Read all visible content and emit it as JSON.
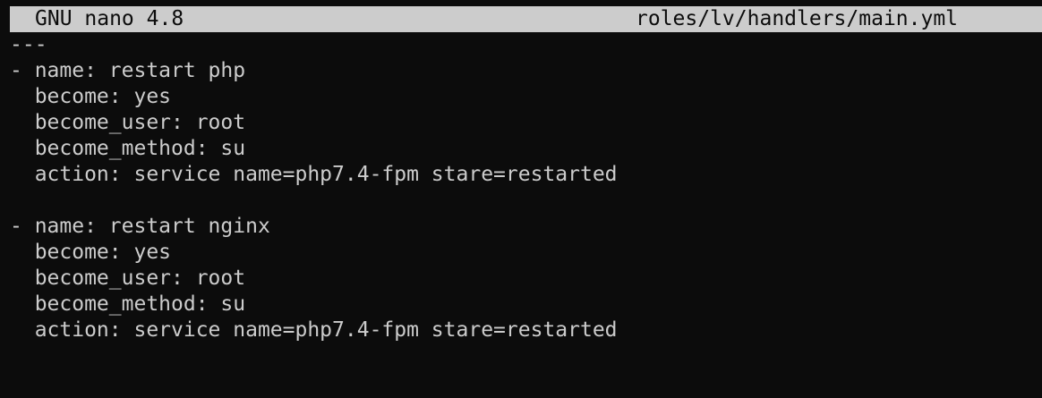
{
  "window": {
    "app_title": "GNU nano 4.8",
    "file_name": "roles/lv/handlers/main.yml"
  },
  "editor": {
    "lines": [
      "---",
      "- name: restart php",
      "  become: yes",
      "  become_user: root",
      "  become_method: su",
      "  action: service name=php7.4-fpm stare=restarted",
      "",
      "- name: restart nginx",
      "  become: yes",
      "  become_user: root",
      "  become_method: su",
      "  action: service name=php7.4-fpm stare=restarted"
    ]
  },
  "colors": {
    "background": "#0c0c0c",
    "foreground": "#cccccc",
    "titlebar_background": "#cccccc",
    "titlebar_foreground": "#0c0c0c"
  }
}
